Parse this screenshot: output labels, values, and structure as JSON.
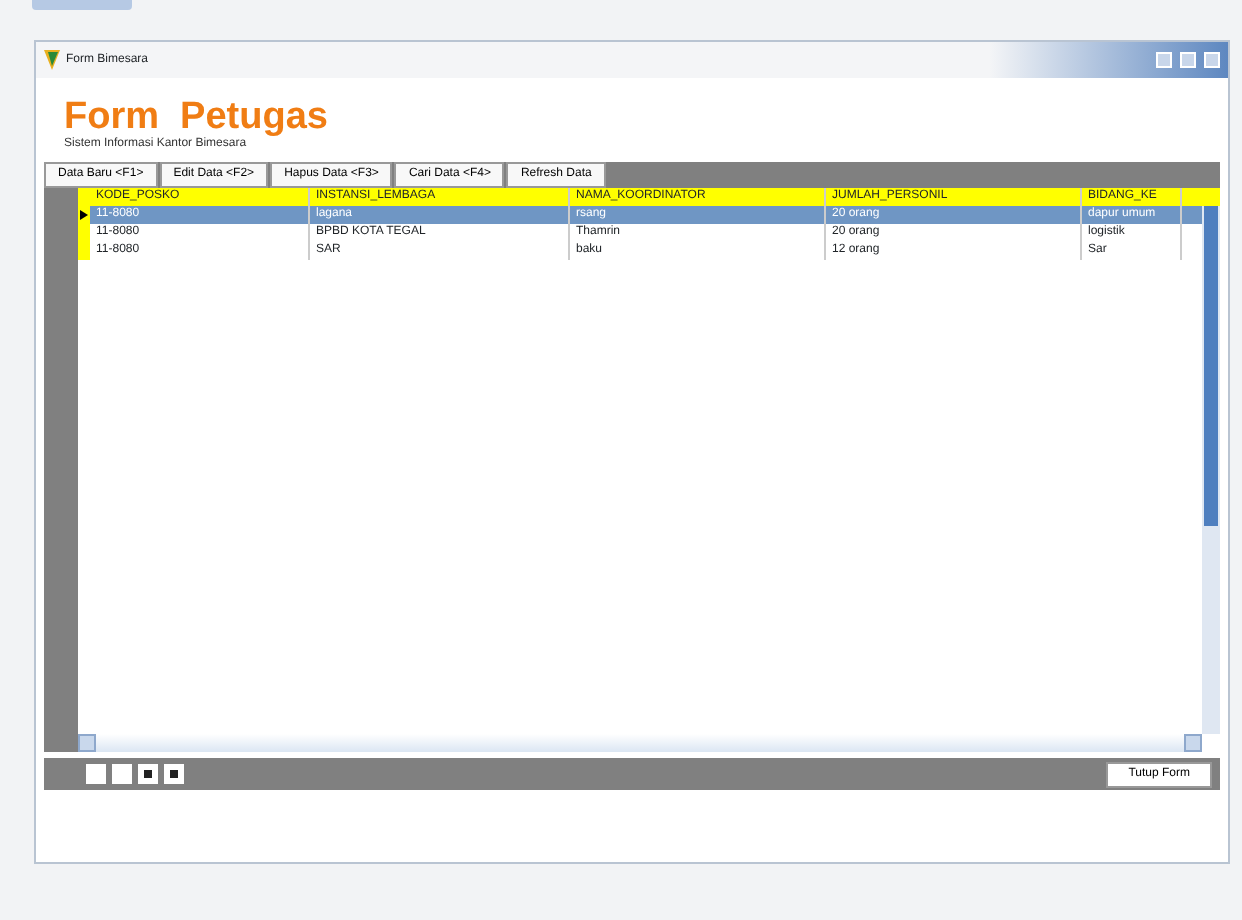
{
  "window": {
    "title": "Form Bimesara"
  },
  "header": {
    "title": "Form  Petugas",
    "subtitle": "Sistem Informasi Kantor Bimesara"
  },
  "toolbar": [
    "Data Baru <F1>",
    "Edit Data <F2>",
    "Hapus Data <F3>",
    "Cari Data <F4>",
    "Refresh Data"
  ],
  "table": {
    "columns": [
      "KODE_POSKO",
      "INSTANSI_LEMBAGA",
      "NAMA_KOORDINATOR",
      "JUMLAH_PERSONIL",
      "BIDANG_KE"
    ],
    "rows": [
      {
        "selected": true,
        "cells": [
          "11-8080",
          "lagana",
          "rsang",
          "20 orang",
          "dapur umum"
        ]
      },
      {
        "selected": false,
        "cells": [
          "11-8080",
          "BPBD KOTA TEGAL",
          "Thamrin",
          "20 orang",
          "logistik"
        ]
      },
      {
        "selected": false,
        "cells": [
          "11-8080",
          "SAR",
          "baku",
          "12 orang",
          "Sar"
        ]
      }
    ]
  },
  "footer": {
    "close_button": "Tutup Form"
  }
}
